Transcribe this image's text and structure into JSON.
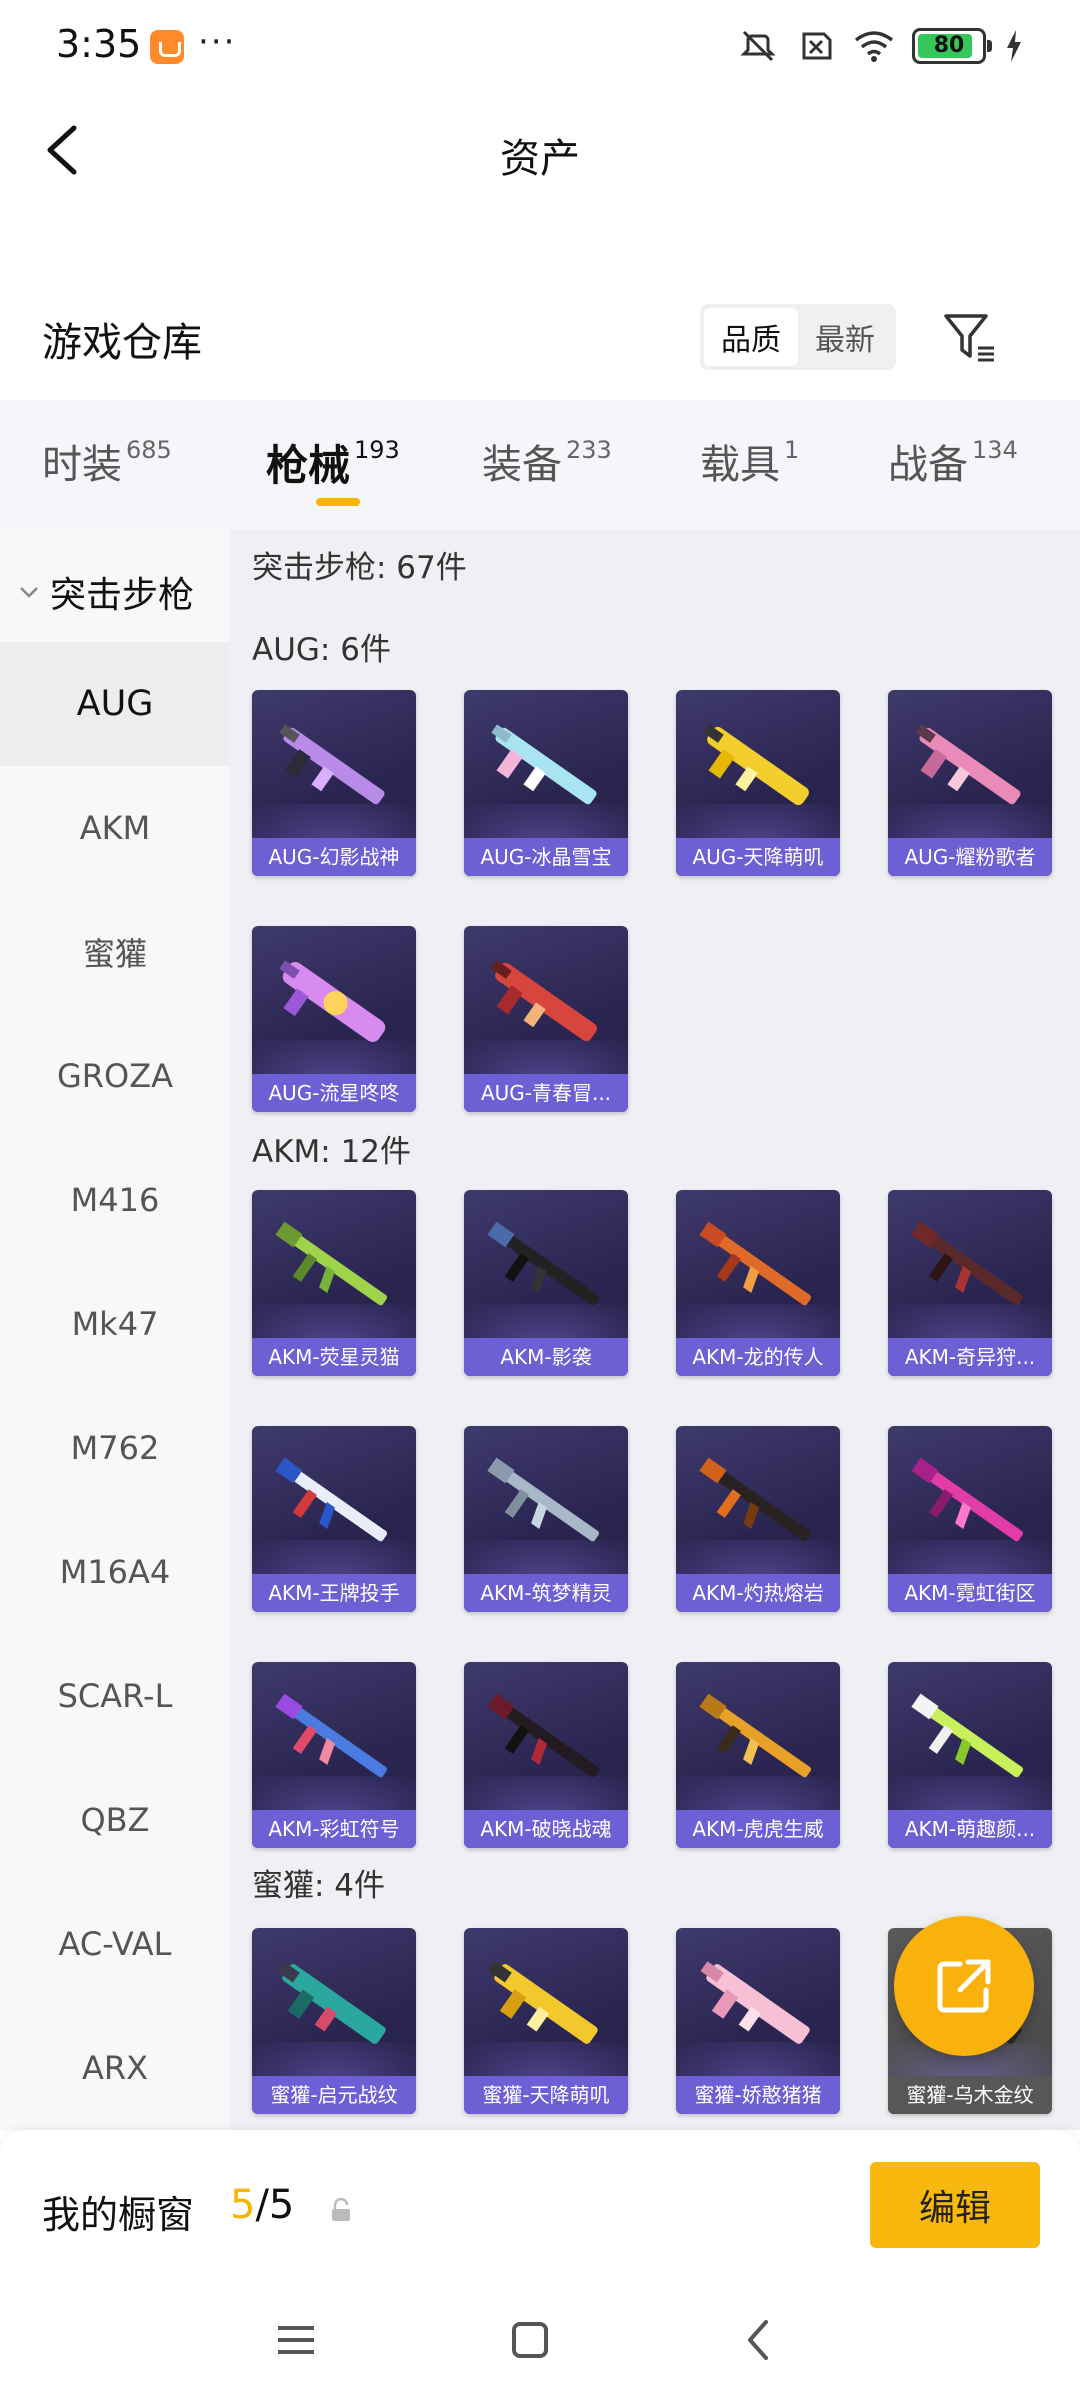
{
  "status_bar": {
    "time": "3:35",
    "more": "···",
    "battery": "80"
  },
  "header": {
    "title": "资产"
  },
  "warehouse": {
    "title": "游戏仓库",
    "sort_options": [
      "品质",
      "最新"
    ],
    "active_sort": "品质"
  },
  "tabs": [
    {
      "label": "时装",
      "count": "685"
    },
    {
      "label": "枪械",
      "count": "193",
      "active": true
    },
    {
      "label": "装备",
      "count": "233"
    },
    {
      "label": "载具",
      "count": "1"
    },
    {
      "label": "战备",
      "count": "134"
    }
  ],
  "sidebar": {
    "category": "突击步枪",
    "items": [
      "AUG",
      "AKM",
      "蜜獾",
      "GROZA",
      "M416",
      "Mk47",
      "M762",
      "M16A4",
      "SCAR-L",
      "QBZ",
      "AC-VAL",
      "ARX"
    ],
    "active": "AUG"
  },
  "content": {
    "total": "突击步枪: 67件",
    "groups": [
      {
        "title": "AUG: 6件",
        "items": [
          "AUG-幻影战神",
          "AUG-冰晶雪宝",
          "AUG-天降萌叽",
          "AUG-耀粉歌者",
          "AUG-流星咚咚",
          "AUG-青春冒..."
        ]
      },
      {
        "title": "AKM: 12件",
        "items": [
          "AKM-荧星灵猫",
          "AKM-影袭",
          "AKM-龙的传人",
          "AKM-奇异狩...",
          "AKM-王牌投手",
          "AKM-筑梦精灵",
          "AKM-灼热熔岩",
          "AKM-霓虹街区",
          "AKM-彩虹符号",
          "AKM-破晓战魂",
          "AKM-虎虎生威",
          "AKM-萌趣颜..."
        ]
      },
      {
        "title": "蜜獾: 4件",
        "items": [
          "蜜獾-启元战纹",
          "蜜獾-天降萌叽",
          "蜜獾-娇憨猪猪",
          "蜜獾-乌木金纹"
        ]
      }
    ]
  },
  "showcase": {
    "label": "我的橱窗",
    "current": "5",
    "total": "/5",
    "edit_label": "编辑"
  },
  "colors": {
    "accent": "#f7b500",
    "card_caption": "#6e5fd4",
    "card_bg": "#2a2550"
  }
}
